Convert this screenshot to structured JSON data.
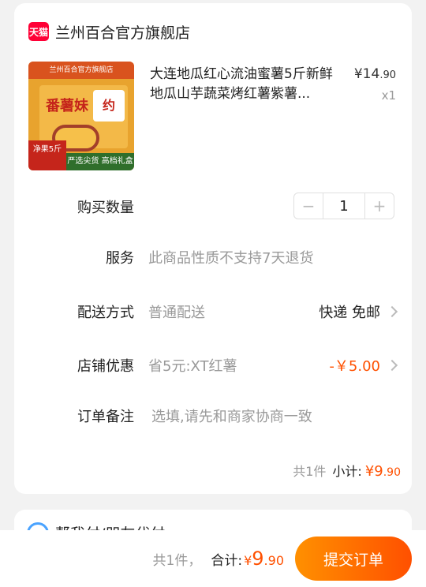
{
  "shop": {
    "logo_text": "天猫",
    "name": "兰州百合官方旗舰店"
  },
  "product": {
    "image": {
      "banner": "兰州百合官方旗舰店",
      "title": "番薯妹",
      "mark": "约",
      "corner": "净果5斤",
      "tagline": "严选尖货 高档礼盒"
    },
    "title": "大连地瓜红心流油蜜薯5斤新鲜地瓜山芋蔬菜烤红薯紫薯...",
    "price_symbol": "¥",
    "price_int": "14",
    "price_dec": ".90",
    "quantity_text": "x1"
  },
  "rows": {
    "quantity": {
      "label": "购买数量",
      "value": "1",
      "minus": "−",
      "plus": "+"
    },
    "service": {
      "label": "服务",
      "value": "此商品性质不支持7天退货"
    },
    "delivery": {
      "label": "配送方式",
      "value": "普通配送",
      "right": "快递 免邮"
    },
    "coupon": {
      "label": "店铺优惠",
      "value": "省5元:XT红薯",
      "right": "-￥5.00"
    },
    "note": {
      "label": "订单备注",
      "placeholder": "选填,请先和商家协商一致"
    }
  },
  "subtotal": {
    "count": "共1件",
    "label": "小计:",
    "symbol": "¥",
    "int": "9",
    "dec": ".90"
  },
  "card2": {
    "text": "帮我付/朋友代付"
  },
  "bottom": {
    "count": "共1件，",
    "label": "合计:",
    "symbol": "¥",
    "int": "9",
    "dec": ".90",
    "submit": "提交订单"
  },
  "colors": {
    "accent": "#ff5000",
    "tmall": "#ff0036"
  }
}
